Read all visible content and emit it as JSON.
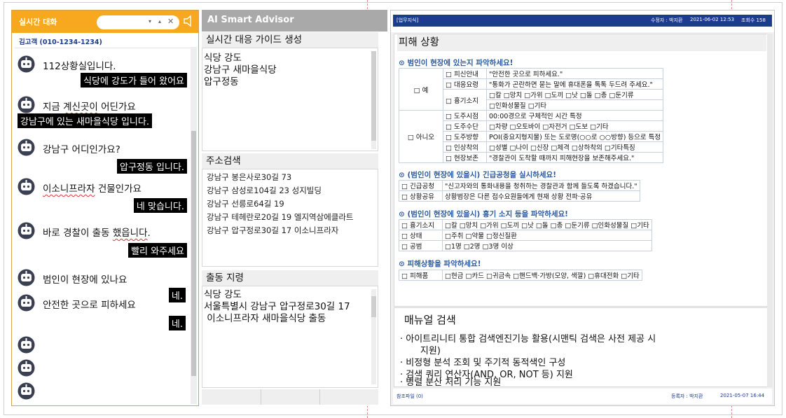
{
  "chat": {
    "title": "실시간 대화",
    "search_close": "✕",
    "caller": "김고객 (010-1234-1234)",
    "messages": [
      {
        "bot": "112상황실입니다.",
        "reply": "식당에 강도가 들어 왔어요"
      },
      {
        "bot": "지금 계신곳이 어딘가요",
        "reply": "강남구에 있는 새마을식당 입니다."
      },
      {
        "bot": "강남구 어디인가요?",
        "reply": "압구정동 입니다."
      },
      {
        "bot": "이소니프라자 건물인가요",
        "reply": "네 맞습니다."
      },
      {
        "bot": "바로 경찰이 출동 했읍니다.",
        "reply": "빨리 와주세요"
      },
      {
        "bot": "범인이 현장에 있나요",
        "reply": "네."
      },
      {
        "bot": "안전한 곳으로 피하세요",
        "reply": "네."
      }
    ]
  },
  "advisor": {
    "title": "AI Smart Advisor",
    "guide": {
      "title": "실시간 대응 가이드 생성",
      "lines": [
        "식당 강도",
        "강남구 새마을식당",
        "압구정동"
      ]
    },
    "address": {
      "title": "주소검색",
      "lines": [
        "강남구 봉은사로30길 73",
        "강남구 삼성로104길 23 성지빌딩",
        "강남구 선릉로64길 19",
        "강남구 테헤란로20길 19 엘지역삼에클라트",
        "강남구 압구정로30길 17 이소니프라자"
      ]
    },
    "dispatch": {
      "title": "출동 지령",
      "lines": [
        "식당 강도",
        "서울특별시 강남구 압구정로30길 17",
        " 이소니프라자 새마을식당 출동"
      ]
    }
  },
  "doc": {
    "bar_left": "[업무지식]",
    "bar_right1": "수정자 : 박지환",
    "bar_right2": "2021-06-02 12:53",
    "bar_right3": "조회수 158",
    "section_title": "피해 상황",
    "q1": "⊙ 범인이 현장에 있는지 파악하세요!",
    "rows1": [
      [
        "□ 예",
        "□ 피신안내",
        "\"안전한 곳으로 피하세요.\""
      ],
      [
        "",
        "□ 대응요령",
        "\"통화가 곤란하면 묻는 말에 휴대폰을 톡톡 두드려 주세요.\""
      ],
      [
        "",
        "□ 흉기소지",
        "□칼 □망치 □가위 □도끼 □낫 □돌 □총 □둔기류"
      ],
      [
        "",
        "",
        "□인화성물질 □기타"
      ],
      [
        "□ 아니오",
        "□ 도주시점",
        "00:00경으로 구체적인 시간 특정"
      ],
      [
        "",
        "□ 도주수단",
        "□차량 □오토바이 □자전거 □도보 □기타"
      ],
      [
        "",
        "□ 도주방향",
        "POI(중요지형지물) 또는 도로명(○○로 ○○방향) 등으로 특정"
      ],
      [
        "",
        "□ 인상착의",
        "□성별 □나이 □신장 □체격 □상하착의 □기타특징"
      ],
      [
        "",
        "□ 현장보존",
        "\"경찰관이 도착할 때까지 피해현장을 보존해주세요.\""
      ]
    ],
    "q2": "⊙ (범인이 현장에 있을시) 긴급공청을 실시하세요!",
    "rows2": [
      [
        "□ 긴급공청",
        "\"신고자와의 통화내용을 청취하는 경찰관과 함께 들도록 하겠습니다.\""
      ],
      [
        "□ 상황공유",
        "상황범장은 다른 접수요원들에게 현재 상황 전파·공유"
      ]
    ],
    "q3": "⊙ (범인이 현장에 있을시) 흉기 소지 등을 파악하세요!",
    "rows3": [
      [
        "□ 흉기소지",
        "□칼 □망치 □가위 □도끼 □낫 □돌 □총 □둔기류 □인화성물질 □기타"
      ],
      [
        "□ 상태",
        "□주취 □약물 □정신질환"
      ],
      [
        "□ 공범",
        "□1명 □2명 □3명 이상"
      ]
    ],
    "q4": "⊙ 피해상황을 파악하세요!",
    "rows4": [
      [
        "□ 피해품",
        "□현금 □카드 □귀금속 □핸드백·가방(모양, 색깔) □휴대전화 □기타"
      ]
    ],
    "manual_title": "매뉴얼 검색",
    "bullets": [
      "· 아이트리니티 통합 검색엔진기능 활용(시맨틱 검색은 사전 제공 시",
      "       지원)",
      "· 비정형 분석 조회 및 주기적 동적색인 구성",
      "· 검색 쿼리 연산자(AND, OR, NOT 등) 지원",
      "· 병렬 분산 처리 기능 지원"
    ],
    "foot_left": "참조파일 (0)",
    "foot_right1": "등록자 : 박지환",
    "foot_right2": "2021-05-07 16:44"
  }
}
